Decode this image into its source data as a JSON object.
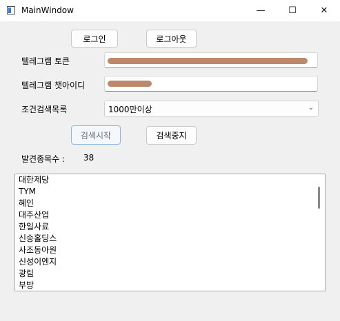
{
  "window": {
    "title": "MainWindow"
  },
  "buttons": {
    "login": "로그인",
    "logout": "로그아웃",
    "start_search": "검색시작",
    "stop_search": "검색중지"
  },
  "form": {
    "token_label": "텔레그램 토큰",
    "chat_id_label": "텔레그램 챗아이디",
    "condition_label": "조건검색목록",
    "condition_selected": "1000만이상"
  },
  "results": {
    "count_label": "발견종목수 :",
    "count_value": "38",
    "items": [
      "대한제당",
      "TYM",
      "혜인",
      "대주산업",
      "한일사료",
      "신송홀딩스",
      "사조동아원",
      "신성이엔지",
      "광림",
      "부방"
    ]
  }
}
